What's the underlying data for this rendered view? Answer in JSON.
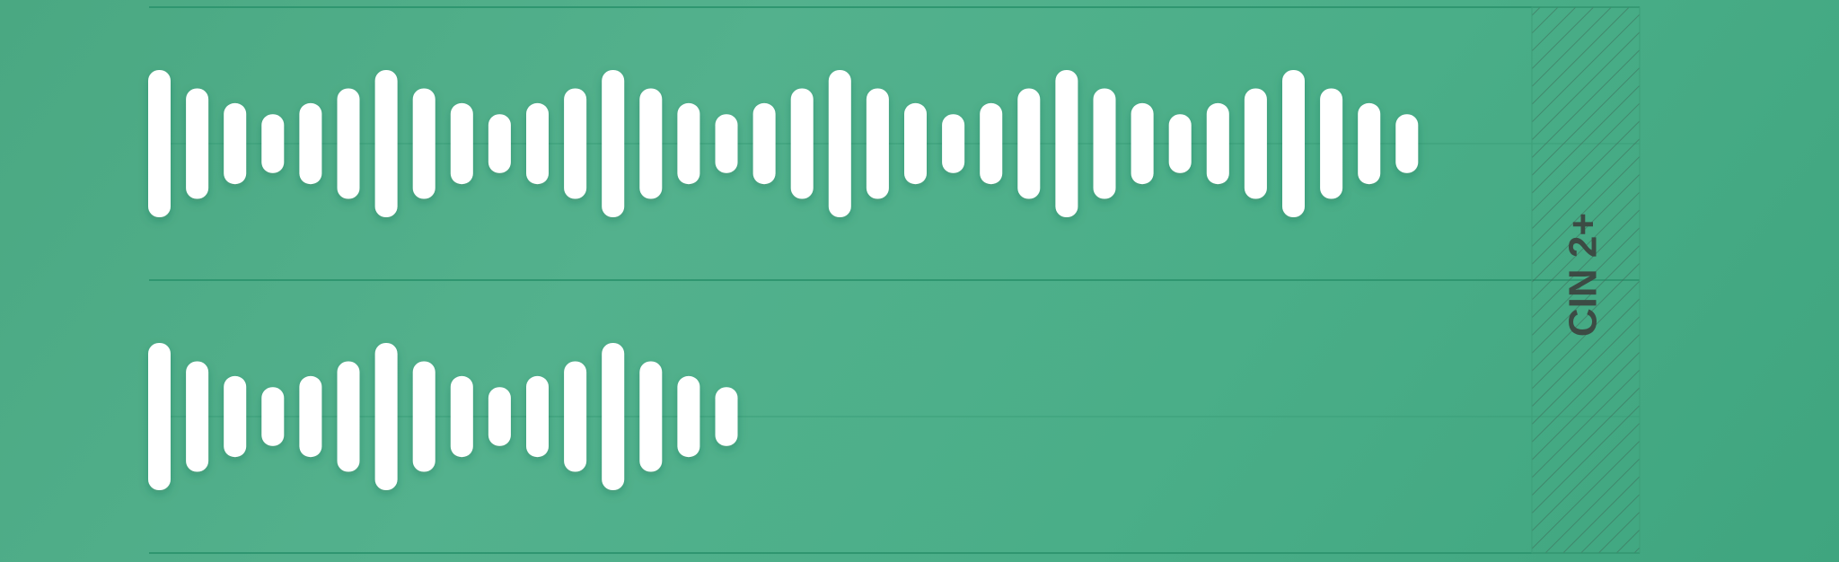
{
  "chart_data": {
    "type": "bar",
    "colors": {
      "background": "#4dab86",
      "bar": "#ffffff",
      "gridline": "#2f9670",
      "band_hatch": "#3d6b59",
      "band_label": "#3c4b44"
    },
    "grid": true,
    "ylim": [
      0,
      2
    ],
    "band": {
      "label": "CIN 2+"
    },
    "series": [
      {
        "values": [
          1.0,
          0.75,
          0.55,
          0.4,
          0.55,
          0.75,
          1.0,
          0.75,
          0.55,
          0.4,
          0.55,
          0.75,
          1.0,
          0.75,
          0.55,
          0.4,
          0.55,
          0.75,
          1.0,
          0.75,
          0.55,
          0.4,
          0.55,
          0.75,
          1.0,
          0.75,
          0.55,
          0.4,
          0.55,
          0.75,
          1.0,
          0.75,
          0.55,
          0.4
        ]
      },
      {
        "values": [
          1.0,
          0.75,
          0.55,
          0.4,
          0.55,
          0.75,
          1.0,
          0.75,
          0.55,
          0.4,
          0.55,
          0.75,
          1.0,
          0.75,
          0.55,
          0.4
        ]
      }
    ]
  }
}
